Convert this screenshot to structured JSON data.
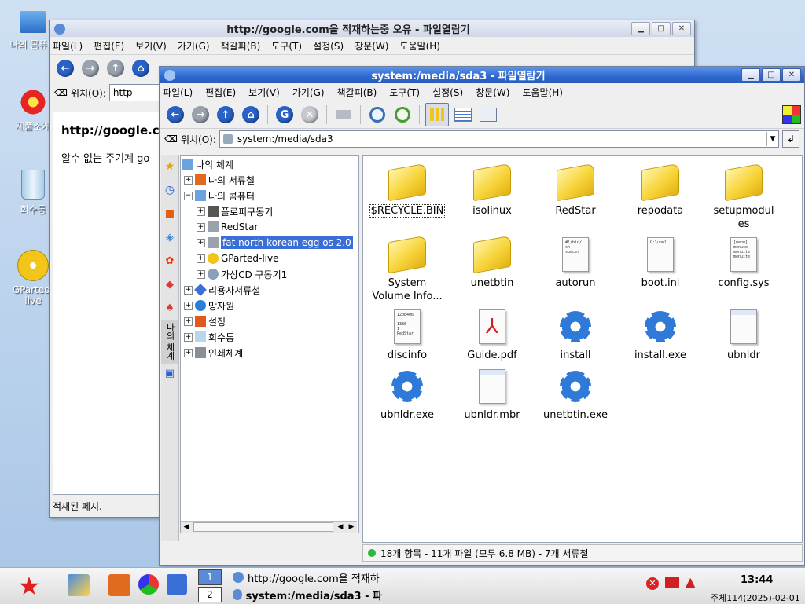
{
  "desktop": {
    "icons": [
      {
        "label": "나의 콤퓨터"
      },
      {
        "label": "제품소개"
      },
      {
        "label": "회수통"
      },
      {
        "label": "GParted-live"
      }
    ]
  },
  "back_window": {
    "title": "http://google.com을 적재하는중 오유 - 파일열람기",
    "menu": [
      "파일(L)",
      "편집(E)",
      "보기(V)",
      "가기(G)",
      "책갈피(B)",
      "도구(T)",
      "설정(S)",
      "창문(W)",
      "도움말(H)"
    ],
    "location_label": "위치(O):",
    "location_value": "http",
    "page_heading": "http://google.c",
    "page_text": "알수 없는 주기계 go",
    "status": "적재된 페지."
  },
  "front_window": {
    "title": "system:/media/sda3 - 파일열람기",
    "menu": [
      "파일(L)",
      "편집(E)",
      "보기(V)",
      "가기(G)",
      "책갈피(B)",
      "도구(T)",
      "설정(S)",
      "창문(W)",
      "도움말(H)"
    ],
    "location_label": "위치(O):",
    "location_value": "system:/media/sda3",
    "sidebar_tab": "나의 체계",
    "tree": [
      {
        "label": "나의 체계",
        "level": 0,
        "toggle": ""
      },
      {
        "label": "나의 서류철",
        "level": 1,
        "toggle": "+"
      },
      {
        "label": "나의 콤퓨터",
        "level": 1,
        "toggle": "−"
      },
      {
        "label": "플로피구동기",
        "level": 2,
        "toggle": "+"
      },
      {
        "label": "RedStar",
        "level": 2,
        "toggle": "+"
      },
      {
        "label": "fat north korean egg os 2.0",
        "level": 2,
        "toggle": "+",
        "selected": true
      },
      {
        "label": "GParted-live",
        "level": 2,
        "toggle": "+"
      },
      {
        "label": "가상CD 구동기1",
        "level": 2,
        "toggle": "+"
      },
      {
        "label": "리용자서류철",
        "level": 0,
        "toggle": "+"
      },
      {
        "label": "망자원",
        "level": 0,
        "toggle": "+"
      },
      {
        "label": "설정",
        "level": 0,
        "toggle": "+"
      },
      {
        "label": "회수통",
        "level": 0,
        "toggle": "+"
      },
      {
        "label": "인쇄체계",
        "level": 0,
        "toggle": "+"
      }
    ],
    "files": [
      {
        "name": "$RECYCLE.BIN",
        "type": "folder",
        "selected": true
      },
      {
        "name": "isolinux",
        "type": "folder"
      },
      {
        "name": "RedStar",
        "type": "folder"
      },
      {
        "name": "repodata",
        "type": "folder"
      },
      {
        "name": "setupmodules",
        "type": "folder"
      },
      {
        "name": "System Volume Info...",
        "type": "folder"
      },
      {
        "name": "unetbtin",
        "type": "folder"
      },
      {
        "name": "autorun",
        "type": "script"
      },
      {
        "name": "boot.ini",
        "type": "ini"
      },
      {
        "name": "config.sys",
        "type": "text"
      },
      {
        "name": "discinfo",
        "type": "text"
      },
      {
        "name": "Guide.pdf",
        "type": "pdf"
      },
      {
        "name": "install",
        "type": "gear"
      },
      {
        "name": "install.exe",
        "type": "gear"
      },
      {
        "name": "ubnldr",
        "type": "blank"
      },
      {
        "name": "ubnldr.exe",
        "type": "gear"
      },
      {
        "name": "ubnldr.mbr",
        "type": "blank"
      },
      {
        "name": "unetbtin.exe",
        "type": "gear"
      }
    ],
    "status": "18개 항목 - 11개 파일 (모두 6.8 MB) - 7개 서류철"
  },
  "taskbar": {
    "desktops": [
      "1",
      "2"
    ],
    "tasks": [
      {
        "label": "http://google.com을 적재하"
      },
      {
        "label": "system:/media/sda3 - 파"
      }
    ],
    "clock_time": "13:44",
    "clock_date": "주체114(2025)-02-01"
  },
  "colors": {
    "title_active": "#2e68d0",
    "selection": "#3a6fd8",
    "folder": "#f7d43a",
    "gear": "#2f7ad8"
  }
}
